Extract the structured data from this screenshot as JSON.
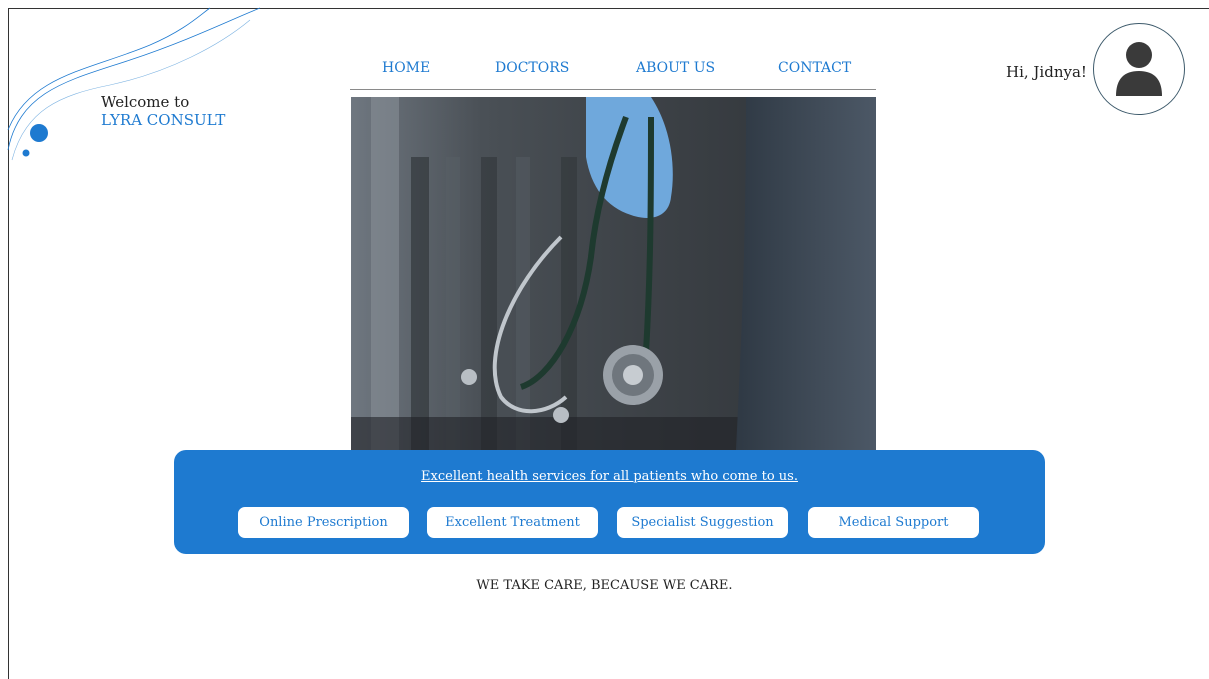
{
  "brand": {
    "welcome": "Welcome to",
    "name": "LYRA CONSULT"
  },
  "nav": {
    "items": [
      "HOME",
      "DOCTORS",
      "ABOUT US",
      "CONTACT"
    ]
  },
  "user": {
    "greeting": "Hi, Jidnya!"
  },
  "banner": {
    "tagline": "Excellent health services for all patients who come to us.",
    "services": [
      "Online  Prescription",
      "Excellent Treatment",
      "Specialist Suggestion",
      "Medical Support"
    ]
  },
  "motto": "WE TAKE CARE, BECAUSE WE CARE.",
  "colors": {
    "accent": "#1e7ad0",
    "text": "#222222"
  },
  "icons": {
    "avatar": "user-avatar-icon"
  }
}
